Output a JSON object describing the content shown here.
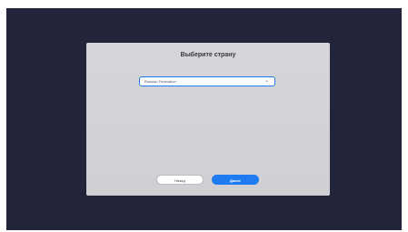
{
  "dialog": {
    "title": "Выберите страну",
    "country_select": {
      "value": "Russian Federation",
      "chevron_icon": "chevron-down-icon"
    },
    "back_label": "Назад",
    "next_label": "Далее"
  },
  "colors": {
    "background": "#22243a",
    "dialog": "#d4d4d8",
    "accent": "#1f7bf2"
  }
}
